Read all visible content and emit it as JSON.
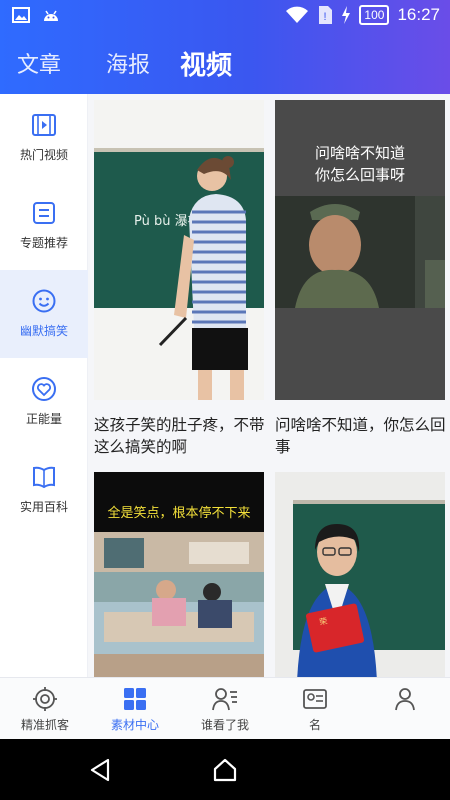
{
  "status_bar": {
    "time": "16:27",
    "battery": "100"
  },
  "top_tabs": [
    {
      "label": "文章",
      "active": false
    },
    {
      "label": "海报",
      "active": false
    },
    {
      "label": "视频",
      "active": true
    }
  ],
  "sidebar": {
    "items": [
      {
        "label": "热门视频",
        "icon": "film-icon",
        "active": false
      },
      {
        "label": "专题推荐",
        "icon": "list-icon",
        "active": false
      },
      {
        "label": "幽默搞笑",
        "icon": "smile-icon",
        "active": true
      },
      {
        "label": "正能量",
        "icon": "heart-icon",
        "active": false
      },
      {
        "label": "实用百科",
        "icon": "book-icon",
        "active": false
      }
    ]
  },
  "videos": [
    {
      "title": "这孩子笑的肚子疼，不带这么搞笑的啊",
      "thumb": "classroom-teacher-blackboard",
      "board_text": "Pù bù 瀑布"
    },
    {
      "title": "问啥啥不知道，你怎么回事",
      "thumb": "meme-officer",
      "overlay_text": "问啥啥不知道\n你怎么回事呀"
    },
    {
      "title": "",
      "thumb": "bedroom-kids",
      "overlay_text": "全是笑点，根本停不下来"
    },
    {
      "title": "",
      "thumb": "student-red-certificate"
    }
  ],
  "bottom_nav": [
    {
      "label": "精准抓客",
      "icon": "target-icon",
      "active": false
    },
    {
      "label": "素材中心",
      "icon": "grid-icon",
      "active": true
    },
    {
      "label": "谁看了我",
      "icon": "user-list-icon",
      "active": false
    },
    {
      "label": "名",
      "icon": "card-icon",
      "active": false
    },
    {
      "label": "",
      "icon": "profile-icon",
      "active": false
    }
  ],
  "colors": {
    "accent": "#3a6ff2",
    "header_start": "#2f6bff",
    "header_end": "#6a4de8"
  }
}
